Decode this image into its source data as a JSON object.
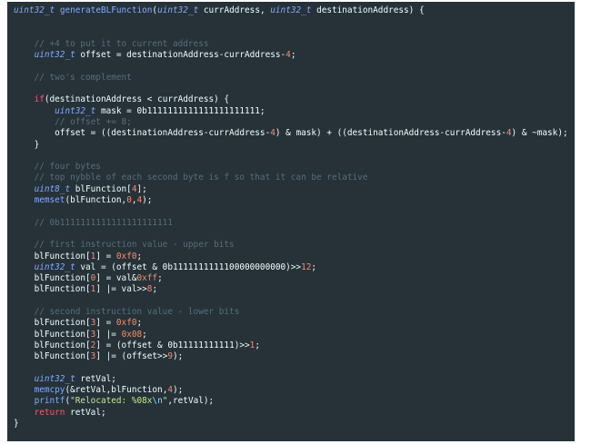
{
  "code": {
    "lines": [
      [
        [
          "type",
          "uint32_t"
        ],
        [
          "id",
          " "
        ],
        [
          "fn",
          "generateBLFunction"
        ],
        [
          "id",
          "("
        ],
        [
          "type",
          "uint32_t"
        ],
        [
          "id",
          " currAddress, "
        ],
        [
          "type",
          "uint32_t"
        ],
        [
          "id",
          " destinationAddress) {"
        ]
      ],
      [],
      [],
      [
        [
          "cm",
          "    // +4 to put it to current address"
        ]
      ],
      [
        [
          "id",
          "    "
        ],
        [
          "type",
          "uint32_t"
        ],
        [
          "id",
          " offset = destinationAddress-currAddress-"
        ],
        [
          "num",
          "4"
        ],
        [
          "id",
          ";"
        ]
      ],
      [],
      [
        [
          "cm",
          "    // two's complement"
        ]
      ],
      [],
      [
        [
          "id",
          "    "
        ],
        [
          "kw",
          "if"
        ],
        [
          "id",
          "(destinationAddress < currAddress) {"
        ]
      ],
      [
        [
          "id",
          "        "
        ],
        [
          "type",
          "uint32_t"
        ],
        [
          "id",
          " mask = 0b1111111111111111111111;"
        ]
      ],
      [
        [
          "cm",
          "        // offset += 8;"
        ]
      ],
      [
        [
          "id",
          "        offset = ((destinationAddress-currAddress-"
        ],
        [
          "num",
          "4"
        ],
        [
          "id",
          ") & mask) + ((destinationAddress-currAddress-"
        ],
        [
          "num",
          "4"
        ],
        [
          "id",
          ") & ~mask);"
        ]
      ],
      [
        [
          "id",
          "    }"
        ]
      ],
      [],
      [
        [
          "cm",
          "    // four bytes"
        ]
      ],
      [
        [
          "cm",
          "    // top nybble of each second byte is f so that it can be relative"
        ]
      ],
      [
        [
          "id",
          "    "
        ],
        [
          "type",
          "uint8_t"
        ],
        [
          "id",
          " blFunction["
        ],
        [
          "num",
          "4"
        ],
        [
          "id",
          "];"
        ]
      ],
      [
        [
          "id",
          "    "
        ],
        [
          "fn",
          "memset"
        ],
        [
          "id",
          "(blFunction,"
        ],
        [
          "num",
          "0"
        ],
        [
          "id",
          ","
        ],
        [
          "num",
          "4"
        ],
        [
          "id",
          ");"
        ]
      ],
      [],
      [
        [
          "cm",
          "    // 0b1111111111111111111111"
        ]
      ],
      [],
      [
        [
          "cm",
          "    // first instruction value - upper bits"
        ]
      ],
      [
        [
          "id",
          "    blFunction["
        ],
        [
          "num",
          "1"
        ],
        [
          "id",
          "] = "
        ],
        [
          "num",
          "0xf0"
        ],
        [
          "id",
          ";"
        ]
      ],
      [
        [
          "id",
          "    "
        ],
        [
          "type",
          "uint32_t"
        ],
        [
          "id",
          " val = (offset & 0b1111111111100000000000)>>"
        ],
        [
          "num",
          "12"
        ],
        [
          "id",
          ";"
        ]
      ],
      [
        [
          "id",
          "    blFunction["
        ],
        [
          "num",
          "0"
        ],
        [
          "id",
          "] = val&"
        ],
        [
          "num",
          "0xff"
        ],
        [
          "id",
          ";"
        ]
      ],
      [
        [
          "id",
          "    blFunction["
        ],
        [
          "num",
          "1"
        ],
        [
          "id",
          "] |= val>>"
        ],
        [
          "num",
          "8"
        ],
        [
          "id",
          ";"
        ]
      ],
      [],
      [
        [
          "cm",
          "    // second instruction value - lower bits"
        ]
      ],
      [
        [
          "id",
          "    blFunction["
        ],
        [
          "num",
          "3"
        ],
        [
          "id",
          "] = "
        ],
        [
          "num",
          "0xf0"
        ],
        [
          "id",
          ";"
        ]
      ],
      [
        [
          "id",
          "    blFunction["
        ],
        [
          "num",
          "3"
        ],
        [
          "id",
          "] |= "
        ],
        [
          "num",
          "0x08"
        ],
        [
          "id",
          ";"
        ]
      ],
      [
        [
          "id",
          "    blFunction["
        ],
        [
          "num",
          "2"
        ],
        [
          "id",
          "] = (offset & 0b11111111111)>>"
        ],
        [
          "num",
          "1"
        ],
        [
          "id",
          ";"
        ]
      ],
      [
        [
          "id",
          "    blFunction["
        ],
        [
          "num",
          "3"
        ],
        [
          "id",
          "] |= (offset>>"
        ],
        [
          "num",
          "9"
        ],
        [
          "id",
          ");"
        ]
      ],
      [],
      [
        [
          "id",
          "    "
        ],
        [
          "type",
          "uint32_t"
        ],
        [
          "id",
          " retVal;"
        ]
      ],
      [
        [
          "id",
          "    "
        ],
        [
          "fn",
          "memcpy"
        ],
        [
          "id",
          "(&retVal,blFunction,"
        ],
        [
          "num",
          "4"
        ],
        [
          "id",
          ");"
        ]
      ],
      [
        [
          "id",
          "    "
        ],
        [
          "fn",
          "printf"
        ],
        [
          "id",
          "("
        ],
        [
          "str",
          "\"Relocated: %08x"
        ],
        [
          "esc",
          "\\n"
        ],
        [
          "str",
          "\""
        ],
        [
          "id",
          ",retVal);"
        ]
      ],
      [
        [
          "id",
          "    "
        ],
        [
          "kw",
          "return"
        ],
        [
          "id",
          " retVal;"
        ]
      ],
      [
        [
          "id",
          "}"
        ]
      ]
    ]
  },
  "colors": {
    "background": "#263238",
    "type": "#82aaff",
    "keyword": "#ff5370",
    "comment": "#546e7a",
    "number": "#f78c6c",
    "string": "#c3e88d",
    "text": "#eeffff"
  }
}
